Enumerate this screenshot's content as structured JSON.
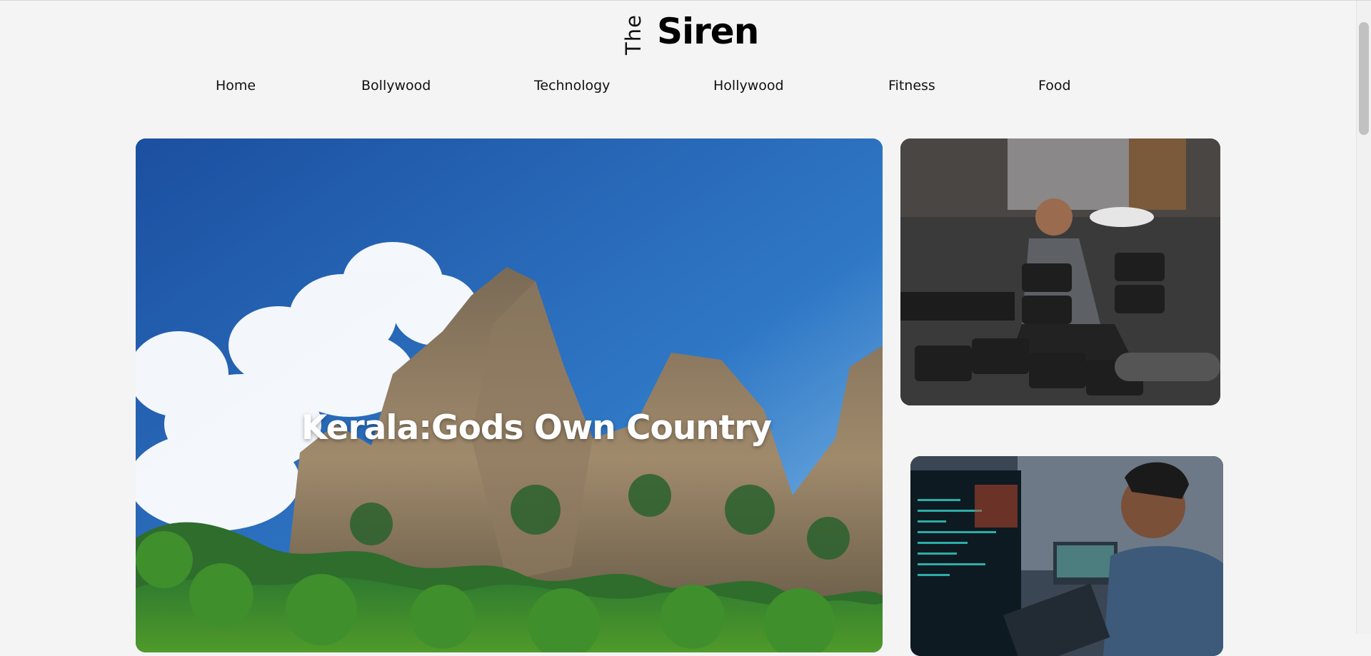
{
  "brand": {
    "the": "The",
    "name": "Siren"
  },
  "nav": {
    "items": [
      "Home",
      "Bollywood",
      "Technology",
      "Hollywood",
      "Fitness",
      "Food"
    ]
  },
  "hero": {
    "title": "Kerala:Gods Own Country"
  },
  "icons": {
    "brand": "logo-icon"
  },
  "colors": {
    "background": "#f4f4f4",
    "text": "#111111",
    "hero_title": "#ffffff"
  }
}
